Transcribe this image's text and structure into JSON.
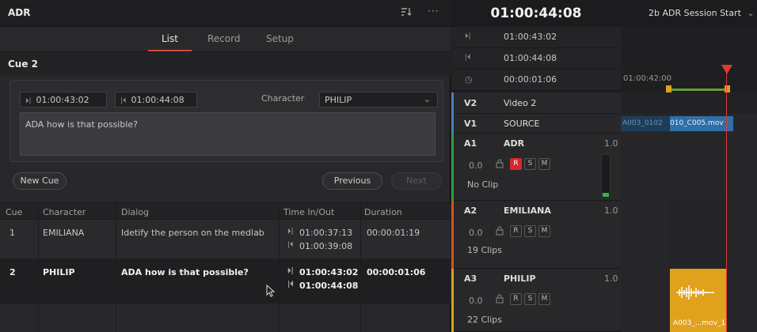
{
  "panel": {
    "title": "ADR"
  },
  "tabs": [
    {
      "label": "List"
    },
    {
      "label": "Record"
    },
    {
      "label": "Setup"
    }
  ],
  "cue": {
    "header": "Cue 2",
    "tc_in": "01:00:43:02",
    "tc_out": "01:00:44:08",
    "character_label": "Character",
    "character_value": "PHILIP",
    "dialog": "ADA how is that possible?"
  },
  "buttons": {
    "new_cue": "New Cue",
    "previous": "Previous",
    "next": "Next"
  },
  "table": {
    "columns": [
      "Cue",
      "Character",
      "Dialog",
      "Time In/Out",
      "Duration"
    ],
    "rows": [
      {
        "cue": "1",
        "character": "EMILIANA",
        "dialog": "Idetify the person on the medlab",
        "time_in": "01:00:37:13",
        "time_out": "01:00:39:08",
        "duration": "00:00:01:19"
      },
      {
        "cue": "2",
        "character": "PHILIP",
        "dialog": "ADA how is that possible?",
        "time_in": "01:00:43:02",
        "time_out": "01:00:44:08",
        "duration": "00:00:01:06"
      }
    ]
  },
  "timeline": {
    "timecode": "01:00:44:08",
    "session": "2b ADR Session Start",
    "in_point": "01:00:43:02",
    "out_point": "01:00:44:08",
    "duration": "00:00:01:06",
    "ruler_label": "01:00:42:00",
    "video_tracks": [
      {
        "id": "V2",
        "name": "Video 2"
      },
      {
        "id": "V1",
        "name": "SOURCE"
      }
    ],
    "audio_tracks": [
      {
        "id": "A1",
        "name": "ADR",
        "level": "1.0",
        "volume": "0.0",
        "clips": "No Clip",
        "color": "#e07a1c"
      },
      {
        "id": "A2",
        "name": "EMILIANA",
        "level": "1.0",
        "volume": "0.0",
        "clips": "19 Clips",
        "color": "#d05a1c"
      },
      {
        "id": "A3",
        "name": "PHILIP",
        "level": "1.0",
        "volume": "0.0",
        "clips": "22 Clips",
        "color": "#e0a11c"
      }
    ],
    "mute_labels": {
      "r": "R",
      "s": "S",
      "m": "M"
    },
    "clips": {
      "v1_clip_dim": "A003_0102",
      "v1_clip": "010_C005.mov",
      "a3_clip": "A003_...mov_1"
    }
  },
  "colors": {
    "accent_red": "#d8262c",
    "tab_underline": "#d24b3a",
    "clip_blue": "#2f6fa8",
    "clip_orange": "#e0a11c",
    "in_out_bar": "#6a9a3a",
    "playhead": "#e03a35"
  }
}
